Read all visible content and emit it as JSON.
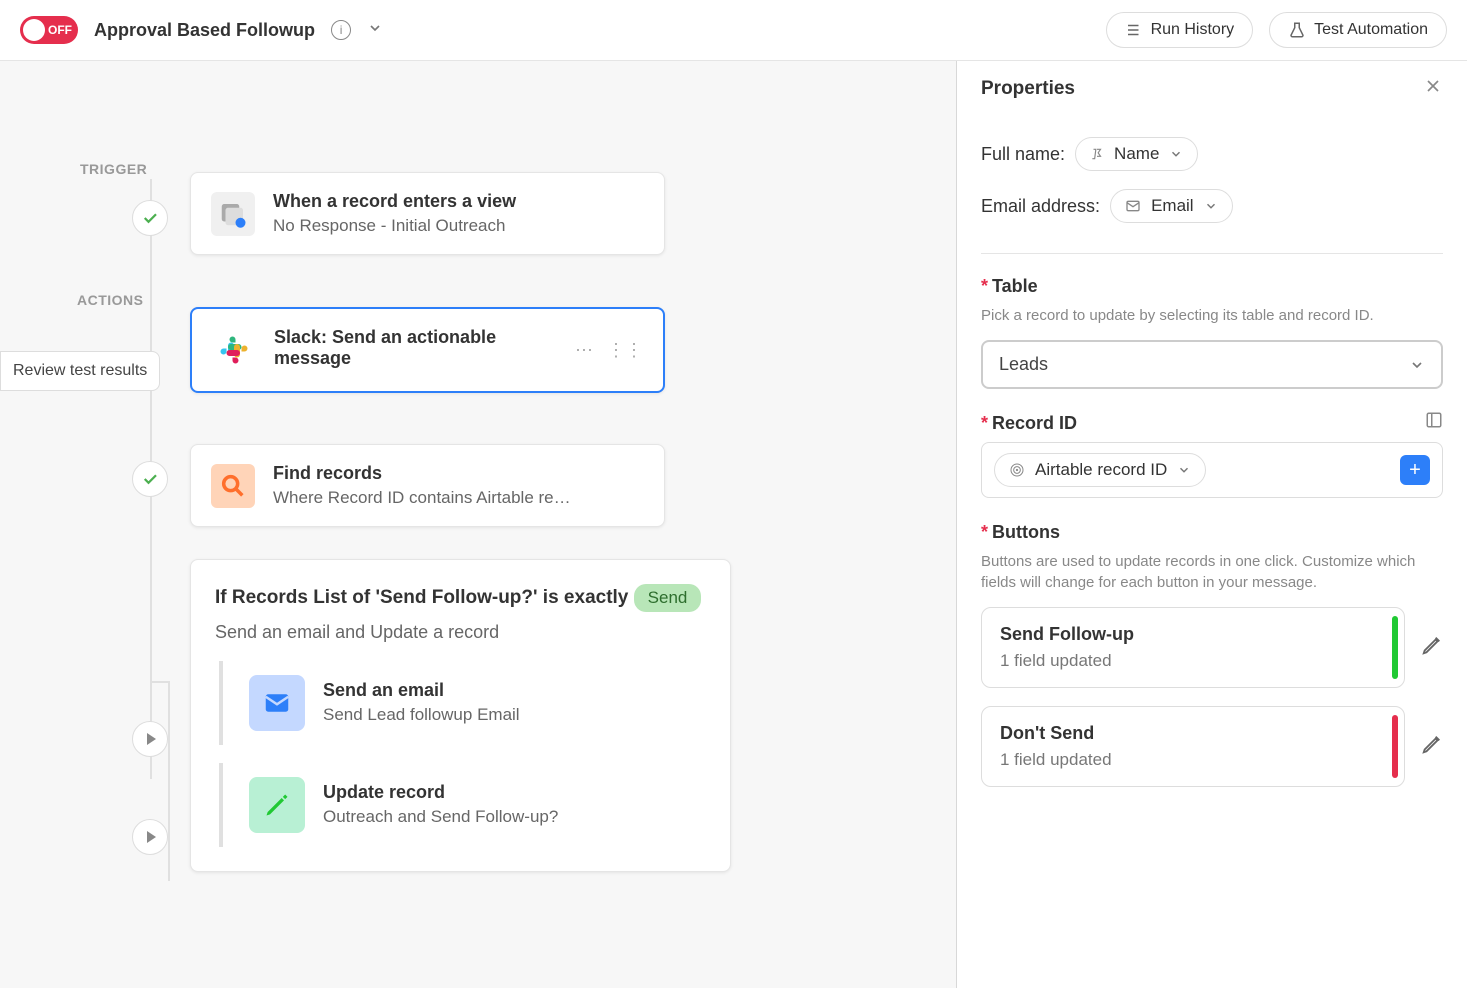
{
  "header": {
    "toggle_state": "OFF",
    "title": "Approval Based Followup",
    "run_history": "Run History",
    "test_automation": "Test Automation"
  },
  "panel": {
    "title": "Properties"
  },
  "canvas": {
    "trigger_label": "TRIGGER",
    "actions_label": "ACTIONS",
    "review_label": "Review test results",
    "trigger_card": {
      "title": "When a record enters a view",
      "sub": "No Response - Initial Outreach"
    },
    "slack_card": {
      "title": "Slack: Send an actionable message"
    },
    "find_card": {
      "title": "Find records",
      "sub": "Where Record ID contains Airtable re…"
    },
    "condition": {
      "text_1": "If Records List of 'Send Follow-up?' is exactly",
      "badge": "Send",
      "sub": "Send an email and Update a record",
      "email": {
        "title": "Send an email",
        "sub": "Send Lead followup Email"
      },
      "update": {
        "title": "Update record",
        "sub": "Outreach and Send Follow-up?"
      }
    }
  },
  "properties": {
    "full_name_label": "Full name:",
    "full_name_token": "Name",
    "email_label": "Email address:",
    "email_token": "Email",
    "table_label": "Table",
    "table_help": "Pick a record to update by selecting its table and record ID.",
    "table_value": "Leads",
    "record_id_label": "Record ID",
    "record_id_token": "Airtable record ID",
    "buttons_label": "Buttons",
    "buttons_help": "Buttons are used to update records in one click. Customize which fields will change for each button in your message.",
    "btn1": {
      "title": "Send Follow-up",
      "sub": "1 field updated"
    },
    "btn2": {
      "title": "Don't Send",
      "sub": "1 field updated"
    }
  }
}
